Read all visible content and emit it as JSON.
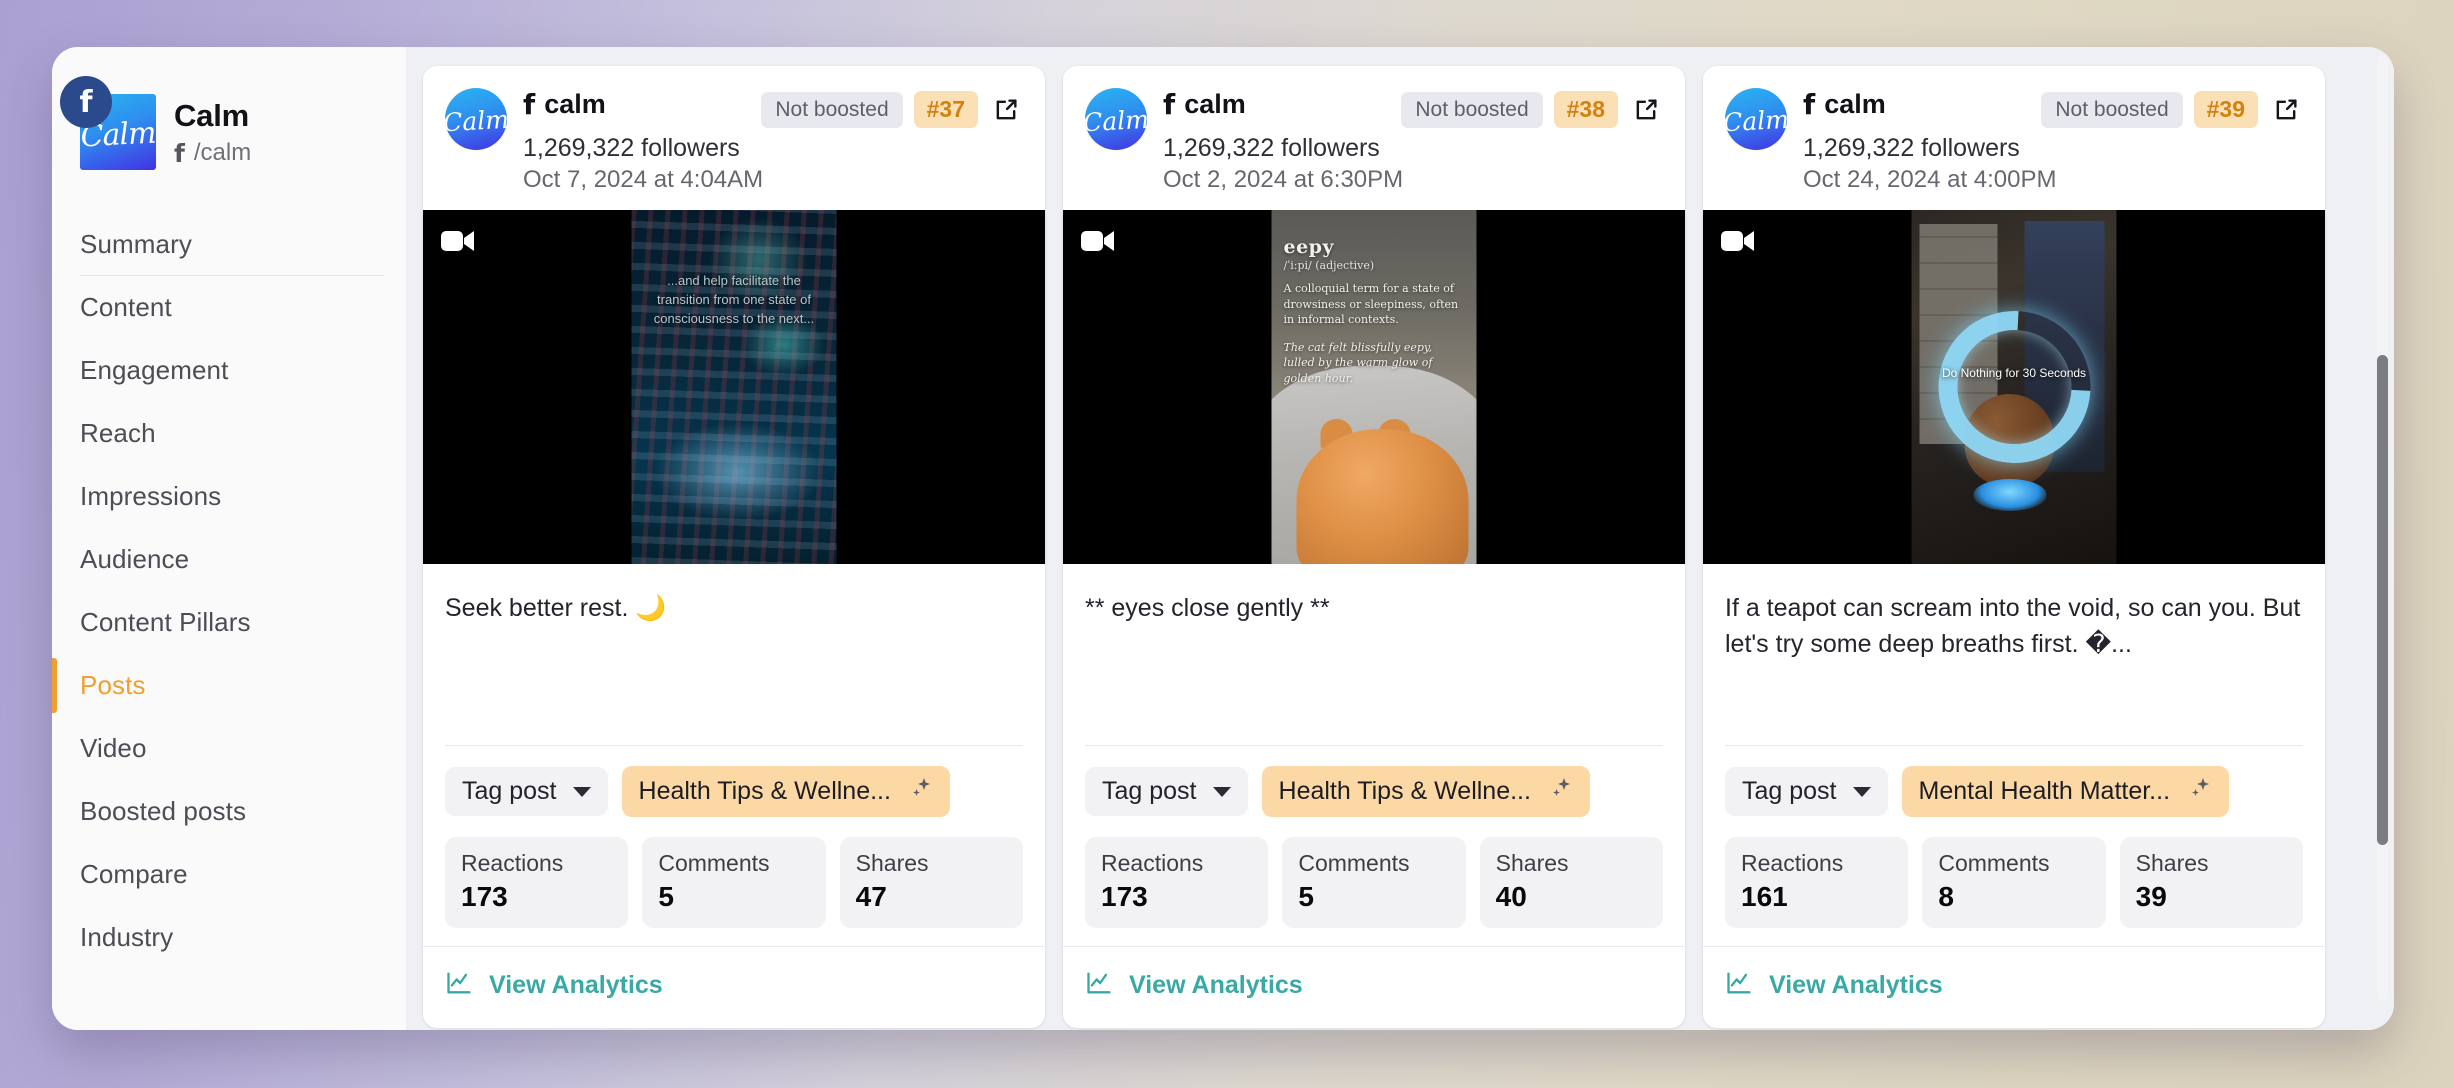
{
  "sidebar": {
    "brand": {
      "name": "Calm",
      "handle": "/calm",
      "logo_text": "Calm",
      "network_icon": "facebook-icon",
      "facebook_glyph": "f"
    },
    "items": [
      {
        "label": "Summary",
        "active": false
      },
      {
        "label": "Content",
        "active": false
      },
      {
        "label": "Engagement",
        "active": false
      },
      {
        "label": "Reach",
        "active": false
      },
      {
        "label": "Impressions",
        "active": false
      },
      {
        "label": "Audience",
        "active": false
      },
      {
        "label": "Content Pillars",
        "active": false
      },
      {
        "label": "Posts",
        "active": true
      },
      {
        "label": "Video",
        "active": false
      },
      {
        "label": "Boosted posts",
        "active": false
      },
      {
        "label": "Compare",
        "active": false
      },
      {
        "label": "Industry",
        "active": false
      }
    ],
    "active_color": "#f0a030"
  },
  "labels": {
    "tag_post": "Tag post",
    "not_boosted": "Not boosted",
    "view_analytics": "View Analytics",
    "reactions": "Reactions",
    "comments": "Comments",
    "shares": "Shares",
    "followers_suffix": "followers",
    "account_name": "calm",
    "avatar_text": "Calm"
  },
  "colors": {
    "accent_orange": "#f0a030",
    "rank_chip_bg": "#fbe0b6",
    "rank_chip_text": "#d2820f",
    "tag_pill_bg": "#fcd8a5",
    "analytics_teal": "#3aa8a4",
    "card_bg": "#ffffff",
    "main_bg": "#eef0f4"
  },
  "posts": [
    {
      "account": "calm",
      "followers": "1,269,322 followers",
      "timestamp": "Oct 7, 2024 at 4:04AM",
      "boost_status": "Not boosted",
      "rank": "#37",
      "media_type": "video",
      "media_caption": "...and help facilitate the transition from one state of consciousness to the next...",
      "text": "Seek better rest. 🌙",
      "tag": "Health Tips & Wellne...",
      "metrics": {
        "reactions": "173",
        "comments": "5",
        "shares": "47"
      }
    },
    {
      "account": "calm",
      "followers": "1,269,322 followers",
      "timestamp": "Oct 2, 2024 at 6:30PM",
      "boost_status": "Not boosted",
      "rank": "#38",
      "media_type": "video",
      "media_word": "eepy",
      "media_ipa": "/ˈiːpi/ (adjective)",
      "media_def": "A colloquial term for a state of drowsiness or sleepiness, often in informal contexts.",
      "media_example": "The cat felt blissfully eepy, lulled by the warm glow of golden hour.",
      "text": "** eyes close gently **",
      "tag": "Health Tips & Wellne...",
      "metrics": {
        "reactions": "173",
        "comments": "5",
        "shares": "40"
      }
    },
    {
      "account": "calm",
      "followers": "1,269,322 followers",
      "timestamp": "Oct 24, 2024 at 4:00PM",
      "boost_status": "Not boosted",
      "rank": "#39",
      "media_type": "video",
      "media_caption": "Do Nothing for\n30 Seconds",
      "text": "If a teapot can scream into the void, so can you. But let's try some deep breaths first. �...",
      "tag": "Mental Health Matter...",
      "metrics": {
        "reactions": "161",
        "comments": "8",
        "shares": "39"
      }
    }
  ]
}
